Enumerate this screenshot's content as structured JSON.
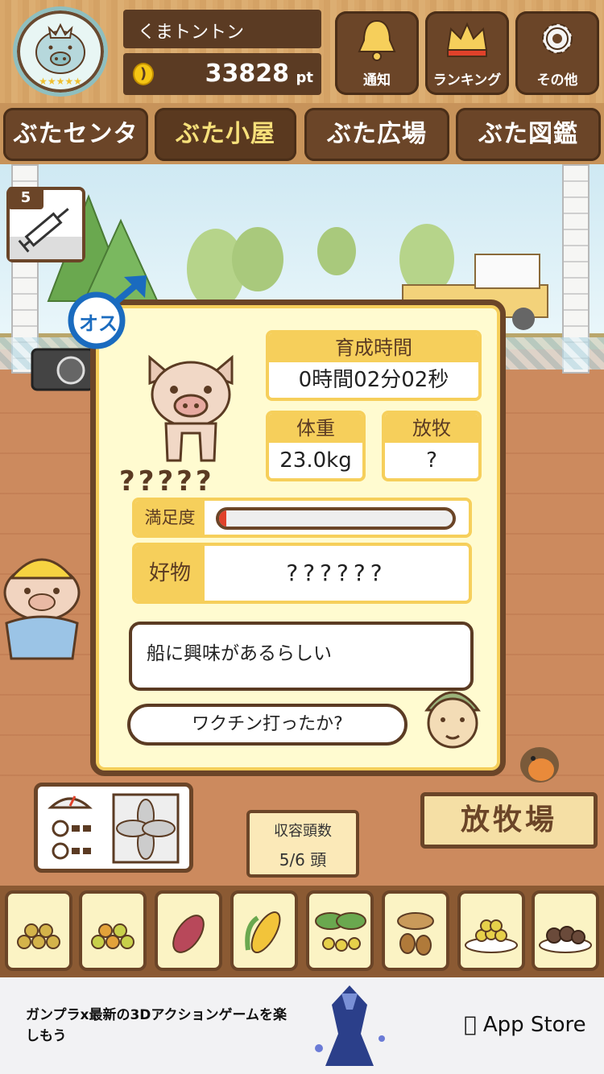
{
  "header": {
    "player_name": "くまトントン",
    "points_value": "33828",
    "points_unit": "pt",
    "coin_icon": "coin-icon",
    "buttons": [
      {
        "label": "通知",
        "icon": "bell-icon"
      },
      {
        "label": "ランキング",
        "icon": "crown-icon"
      },
      {
        "label": "その他",
        "icon": "gear-icon"
      }
    ]
  },
  "tabs": [
    {
      "label": "ぶたセンター",
      "active": false
    },
    {
      "label": "ぶた小屋",
      "active": true
    },
    {
      "label": "ぶた広場",
      "active": false
    },
    {
      "label": "ぶた図鑑",
      "active": false
    }
  ],
  "vaccine": {
    "count": "5",
    "icon": "syringe-icon"
  },
  "pig_card": {
    "gender_label": "オス",
    "pig_name": "?????",
    "growth_time_label": "育成時間",
    "growth_time_value": "0時間02分02秒",
    "weight_label": "体重",
    "weight_value": "23.0kg",
    "grazing_label": "放牧",
    "grazing_value": "?",
    "satisfaction_label": "満足度",
    "satisfaction_level": 0.03,
    "favorite_label": "好物",
    "favorite_value": "??????",
    "speech_main": "船に興味があるらしい",
    "speech_question": "ワクチン打ったか?"
  },
  "capacity": {
    "label": "収容頭数",
    "value": "5/6 頭"
  },
  "pasture_sign": "放牧場",
  "foods": [
    "grain-icon",
    "mixed-grain-icon",
    "sweet-potato-icon",
    "corn-icon",
    "leaf-berry-icon",
    "acorn-icon",
    "bean-plate-icon",
    "truffle-plate-icon"
  ],
  "ad": {
    "text": "ガンプラx最新の3Dアクションゲームを楽しもう",
    "store_label": "App Store"
  },
  "colors": {
    "wood": "#6b4528",
    "accent": "#f6cf5b",
    "card_bg": "#fffbd0"
  }
}
